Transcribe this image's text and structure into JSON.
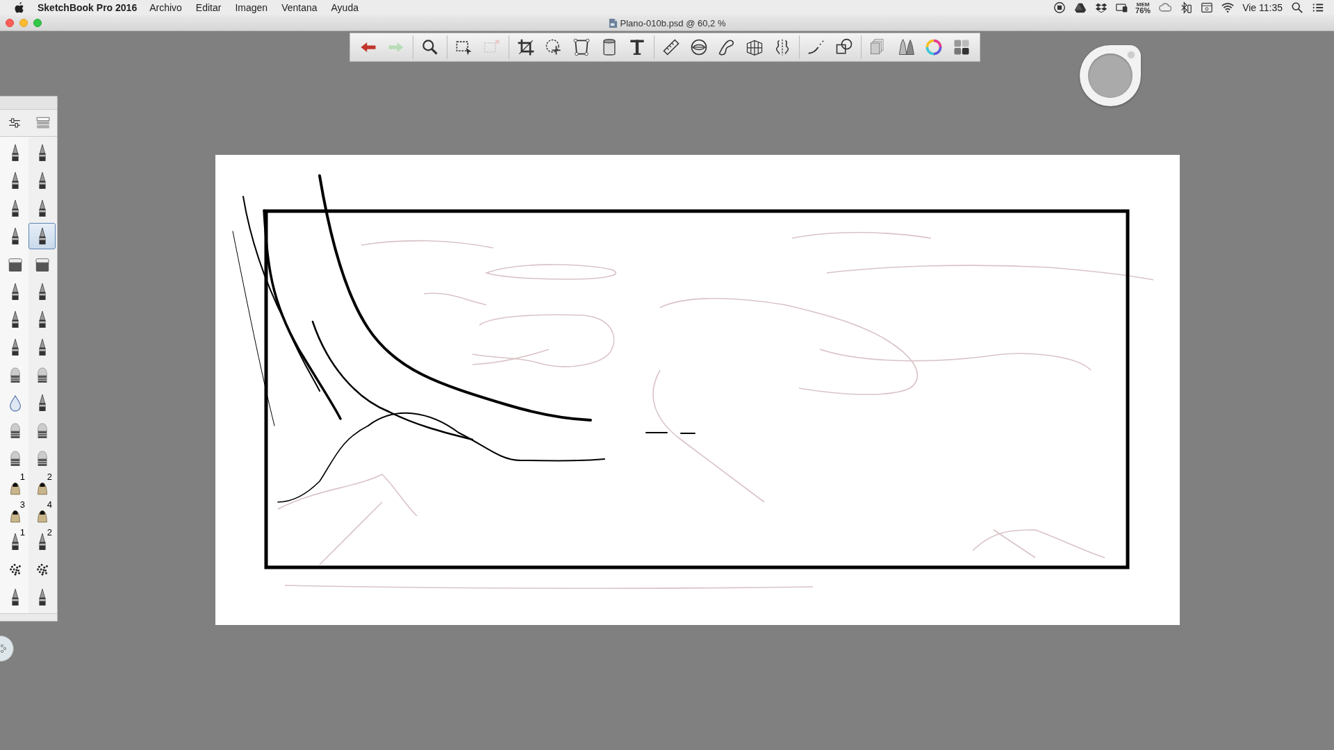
{
  "menu_bar": {
    "app_name": "SketchBook Pro 2016",
    "menus": [
      "Archivo",
      "Editar",
      "Imagen",
      "Ventana",
      "Ayuda"
    ],
    "status": {
      "memory_label": "MEM",
      "memory_value": "76%",
      "clock": "Vie 11:35"
    }
  },
  "window": {
    "title": "Plano-010b.psd @ 60,2 %"
  },
  "toolbar": {
    "groups": [
      [
        {
          "kind": "undo",
          "disabled": false
        },
        {
          "kind": "redo",
          "disabled": true
        }
      ],
      [
        {
          "kind": "zoom",
          "disabled": false
        }
      ],
      [
        {
          "kind": "select",
          "disabled": false
        },
        {
          "kind": "clear-select",
          "disabled": true
        }
      ],
      [
        {
          "kind": "crop",
          "disabled": false
        },
        {
          "kind": "move",
          "disabled": false
        },
        {
          "kind": "distort",
          "disabled": false
        },
        {
          "kind": "fill",
          "disabled": false
        },
        {
          "kind": "text",
          "disabled": false
        }
      ],
      [
        {
          "kind": "ruler",
          "disabled": false
        },
        {
          "kind": "ellipse",
          "disabled": false
        },
        {
          "kind": "curve",
          "disabled": false
        },
        {
          "kind": "perspective",
          "disabled": false
        },
        {
          "kind": "symmetry",
          "disabled": false
        }
      ],
      [
        {
          "kind": "stroke",
          "disabled": false
        },
        {
          "kind": "shapes",
          "disabled": false
        }
      ],
      [
        {
          "kind": "layers",
          "disabled": false
        },
        {
          "kind": "brushes",
          "disabled": false
        },
        {
          "kind": "color",
          "disabled": false
        },
        {
          "kind": "swatches",
          "disabled": false
        }
      ]
    ]
  },
  "brush_palette": {
    "brushes": [
      {
        "kind": "pen",
        "selected": false
      },
      {
        "kind": "pen",
        "selected": false
      },
      {
        "kind": "pen",
        "selected": false
      },
      {
        "kind": "pen",
        "selected": false
      },
      {
        "kind": "pen",
        "selected": false
      },
      {
        "kind": "pen",
        "selected": false
      },
      {
        "kind": "pen",
        "selected": false
      },
      {
        "kind": "pen",
        "selected": true
      },
      {
        "kind": "eraser",
        "selected": false
      },
      {
        "kind": "eraser",
        "selected": false
      },
      {
        "kind": "pen",
        "selected": false
      },
      {
        "kind": "pen",
        "selected": false
      },
      {
        "kind": "pen",
        "selected": false
      },
      {
        "kind": "pen",
        "selected": false
      },
      {
        "kind": "pen",
        "selected": false
      },
      {
        "kind": "pen",
        "selected": false
      },
      {
        "kind": "brush",
        "selected": false
      },
      {
        "kind": "brush",
        "selected": false
      },
      {
        "kind": "drop",
        "selected": false
      },
      {
        "kind": "pen",
        "selected": false
      },
      {
        "kind": "brush",
        "selected": false
      },
      {
        "kind": "brush",
        "selected": false
      },
      {
        "kind": "brush",
        "selected": false
      },
      {
        "kind": "brush",
        "selected": false
      },
      {
        "kind": "nib",
        "selected": false,
        "number": "1"
      },
      {
        "kind": "nib",
        "selected": false,
        "number": "2"
      },
      {
        "kind": "nib",
        "selected": false,
        "number": "3"
      },
      {
        "kind": "nib",
        "selected": false,
        "number": "4"
      },
      {
        "kind": "pen",
        "selected": false,
        "number": "1"
      },
      {
        "kind": "pen",
        "selected": false,
        "number": "2"
      },
      {
        "kind": "splatter",
        "selected": false
      },
      {
        "kind": "splatter",
        "selected": false
      },
      {
        "kind": "pen",
        "selected": false
      },
      {
        "kind": "pen",
        "selected": false
      }
    ]
  }
}
